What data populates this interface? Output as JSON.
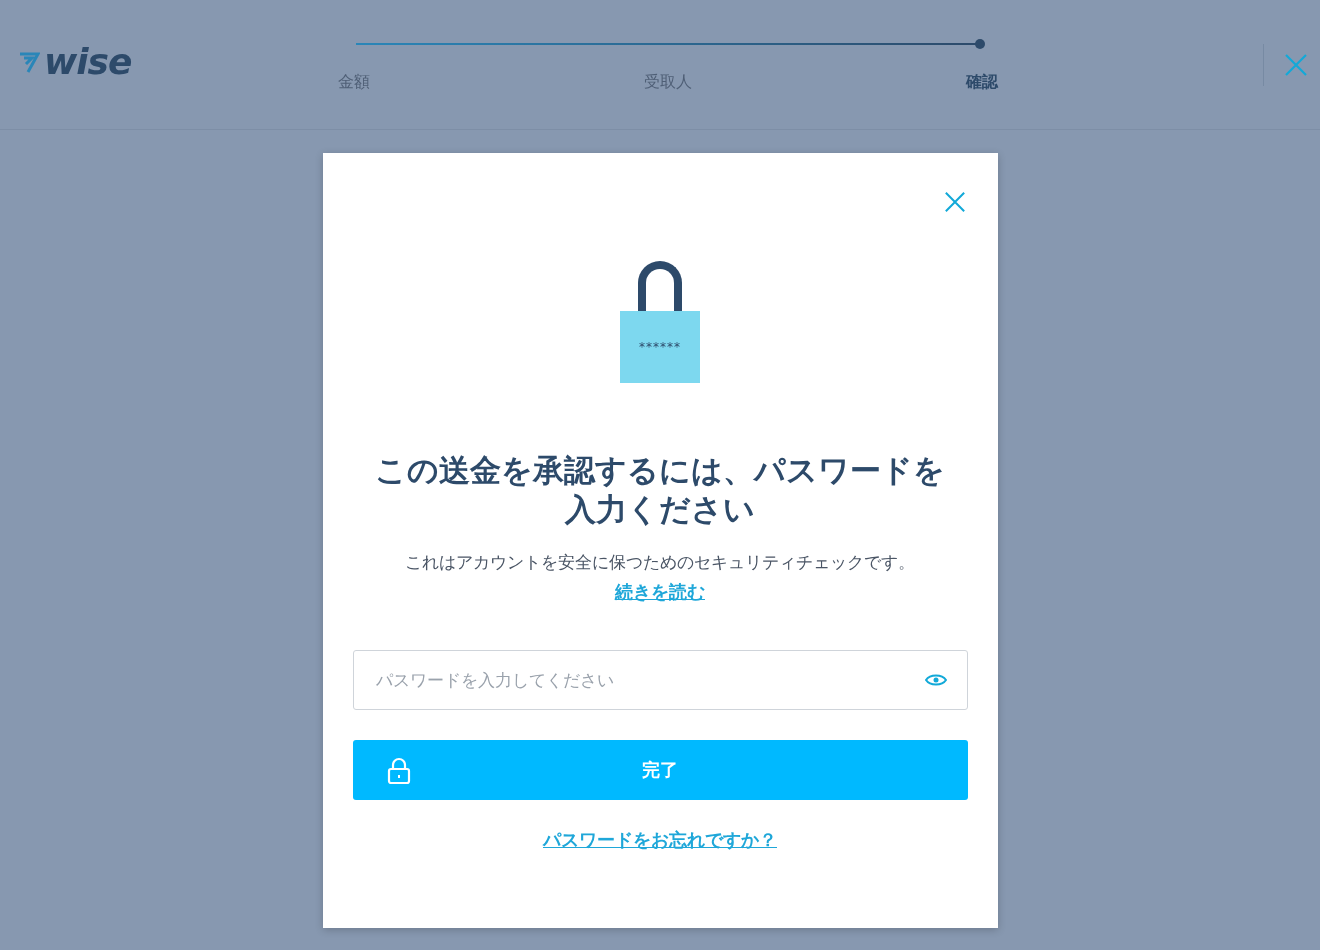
{
  "header": {
    "logo": "wise",
    "steps": [
      {
        "label": "金額",
        "selected": false
      },
      {
        "label": "受取人",
        "selected": false
      },
      {
        "label": "確認",
        "selected": true
      }
    ]
  },
  "modal": {
    "lock_text": "******",
    "title": "この送金を承認するには、パスワードを入力ください",
    "description": "これはアカウントを安全に保つためのセキュリティチェックです。",
    "read_more": "続きを読む",
    "password": {
      "placeholder": "パスワードを入力してください"
    },
    "submit": "完了",
    "forgot": "パスワードをお忘れですか？"
  }
}
